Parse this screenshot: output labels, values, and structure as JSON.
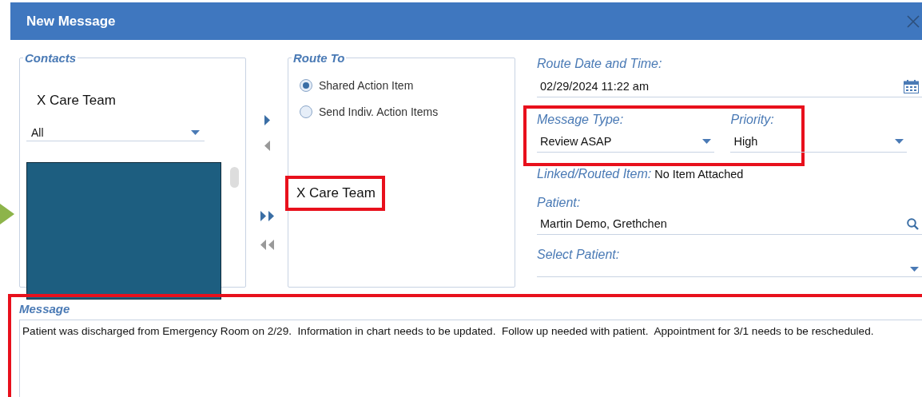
{
  "window": {
    "title": "New Message"
  },
  "contacts": {
    "legend": "Contacts",
    "team": "X Care Team",
    "filter": "All"
  },
  "route_to": {
    "legend": "Route To",
    "options": [
      {
        "label": "Shared Action Item",
        "selected": true
      },
      {
        "label": "Send Indiv. Action Items",
        "selected": false
      }
    ],
    "recipients": [
      {
        "name": "X Care Team",
        "highlighted": true
      }
    ]
  },
  "form": {
    "route_date": {
      "label": "Route Date and Time:",
      "value": "02/29/2024 11:22 am"
    },
    "type_priority": {
      "highlighted": true,
      "message_type": {
        "label": "Message Type:",
        "value": "Review ASAP"
      },
      "priority": {
        "label": "Priority:",
        "value": "High"
      }
    },
    "linked": {
      "label": "Linked/Routed Item:",
      "value": "No Item Attached"
    },
    "patient": {
      "label": "Patient:",
      "value": "Martin Demo, Grethchen"
    },
    "select_patient": {
      "label": "Select Patient:"
    }
  },
  "message": {
    "legend": "Message",
    "highlighted": true,
    "value": "Patient was discharged from Emergency Room on 2/29.  Information in chart needs to be updated.  Follow up needed with patient.  Appointment for 3/1 needs to be rescheduled."
  }
}
